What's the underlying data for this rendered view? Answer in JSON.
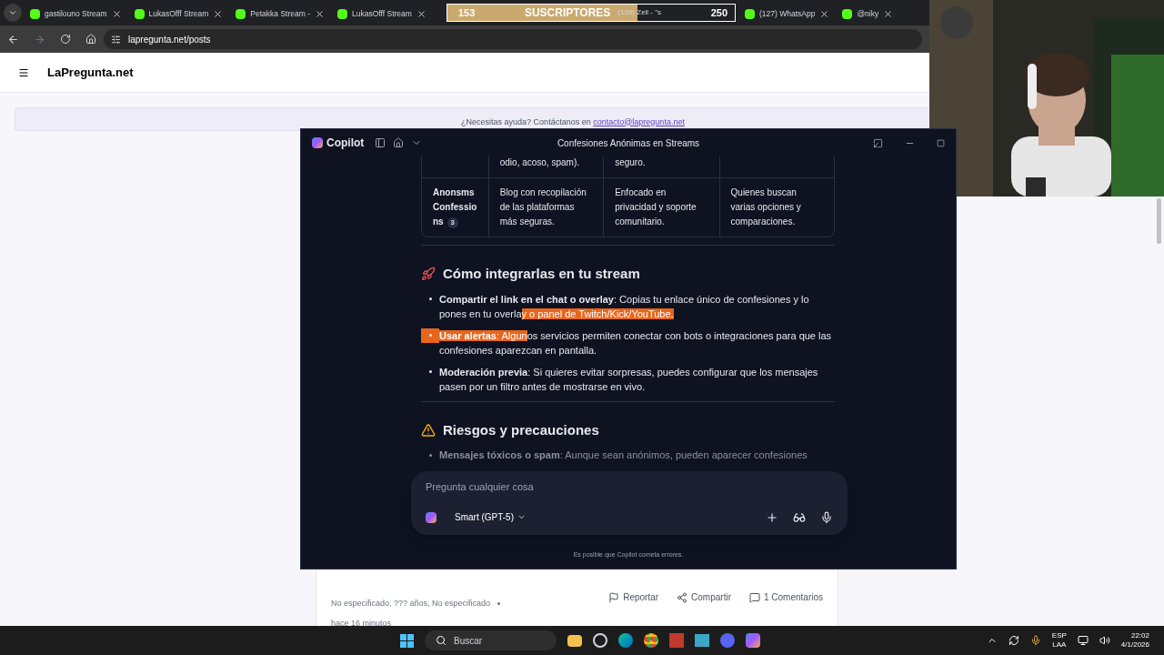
{
  "browser": {
    "tabs": [
      {
        "label": "gastilouno Stream",
        "selected": false
      },
      {
        "label": "LukasOfff Stream",
        "selected": false
      },
      {
        "label": "Petakka Stream -",
        "selected": false
      },
      {
        "label": "LukasOfff Stream",
        "selected": false
      },
      {
        "label": "(127) WhatsApp",
        "selected": false
      },
      {
        "label": "@niky",
        "selected": false
      }
    ],
    "url": "lapregunta.net/posts"
  },
  "sub_goal": {
    "current": "153",
    "label": "SUSCRIPTORES",
    "target": "250",
    "level": 0.66,
    "behind_text": "(198) Zell - \"s"
  },
  "site": {
    "title": "LaPregunta.net",
    "help_text": "¿Necesitas ayuda? Contáctanos en",
    "help_link": "contacto@lapregunta.net",
    "post": {
      "meta": "No especificado, ??? años, No especificado",
      "time": "hace 16 minutos",
      "actions": [
        {
          "kind": "flag",
          "label": "Reportar"
        },
        {
          "kind": "share",
          "label": "Compartir"
        },
        {
          "kind": "comment",
          "label": "1 Comentarios"
        }
      ]
    }
  },
  "copilot": {
    "app_name": "Copilot",
    "title": "Confesiones Anónimas en Streams",
    "table_rows": [
      {
        "cells": [
          "",
          "odio, acoso, spam).",
          "seguro.",
          ""
        ]
      },
      {
        "cells": [
          "Anonsms Confessions",
          "Blog con recopilación de las plataformas más seguras.",
          "Enfocado en privacidad y soporte comunitario.",
          "Quienes buscan varias opciones y comparaciones."
        ],
        "citation": "3"
      }
    ],
    "sections": [
      {
        "kind": "rocket",
        "heading": "Cómo integrarlas en tu stream",
        "faded": false,
        "bullets": [
          {
            "highlighted": false,
            "segments": [
              {
                "text": "**Compartir el link en el chat o overlay**: Copias tu enlace único de confesiones y lo pones en tu overla",
                "highlighted": false
              },
              {
                "text": "y o panel de Twitch/Kick/YouTube.",
                "highlighted": true
              }
            ]
          },
          {
            "highlighted": true,
            "segments": [
              {
                "text": "**Usar alertas**: Algun",
                "highlighted": true
              },
              {
                "text": "os servicios permiten conectar con bots o integraciones para que las confesiones aparezcan en pantalla.",
                "highlighted": false
              }
            ]
          },
          {
            "highlighted": false,
            "segments": [
              {
                "text": "**Moderación previa**: Si quieres evitar sorpresas, puedes configurar que los mensajes pasen por un filtro antes de mostrarse en vivo.",
                "highlighted": false
              }
            ]
          }
        ]
      },
      {
        "kind": "warning",
        "heading": "Riesgos y precauciones",
        "faded": true,
        "bullets": [
          {
            "highlighted": false,
            "segments": [
              {
                "text": "**Mensajes tóxicos o spam**: Aunque sean anónimos, pueden aparecer confesiones",
                "highlighted": false
              }
            ]
          }
        ]
      }
    ],
    "input": {
      "placeholder": "Pregunta cualquier cosa",
      "model": "Smart (GPT-5)"
    },
    "disclaimer": "Es posible que Copilot cometa errores."
  },
  "taskbar": {
    "search_placeholder": "Buscar",
    "language": "ESP",
    "layout": "LAA",
    "time": "22:02",
    "date": "4/1/2026"
  }
}
